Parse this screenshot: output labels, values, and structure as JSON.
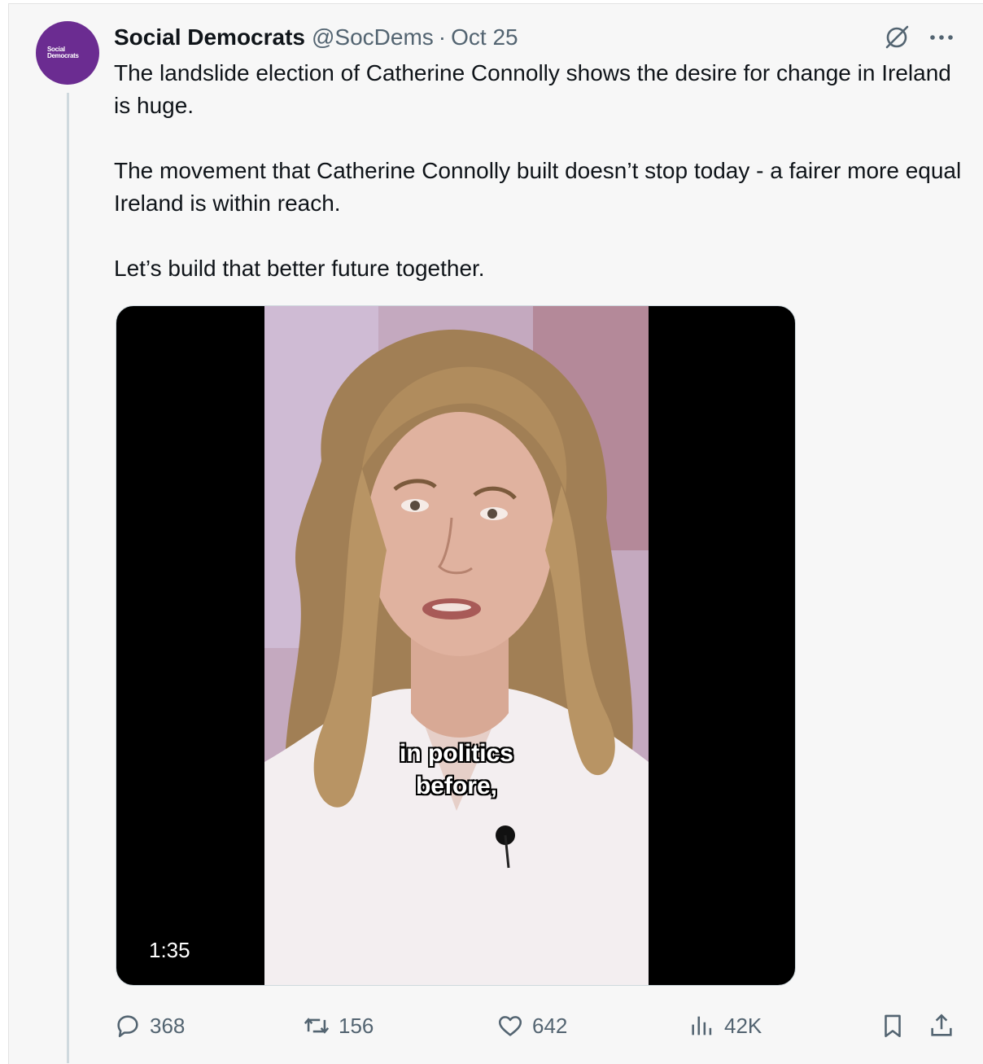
{
  "tweet": {
    "avatar_text_line1": "Social",
    "avatar_text_line2": "Democrats",
    "display_name": "Social Democrats",
    "handle": "@SocDems",
    "separator": "·",
    "date": "Oct 25",
    "paragraphs": [
      "The landslide election of Catherine Connolly shows the desire for change in Ireland is huge.",
      "The movement that Catherine Connolly built doesn’t stop today - a fairer more equal Ireland is within reach.",
      "Let’s build that better future together."
    ]
  },
  "media": {
    "caption_line1": "in politics",
    "caption_line2": "before,",
    "duration": "1:35"
  },
  "actions": {
    "replies": "368",
    "reposts": "156",
    "likes": "642",
    "views": "42K"
  },
  "colors": {
    "avatar": "#6b2c91",
    "text": "#0f1419",
    "muted": "#536471",
    "background": "#f7f7f7"
  },
  "icons": [
    "grok-icon",
    "more-icon",
    "reply-icon",
    "repost-icon",
    "like-icon",
    "views-icon",
    "bookmark-icon",
    "share-icon"
  ]
}
